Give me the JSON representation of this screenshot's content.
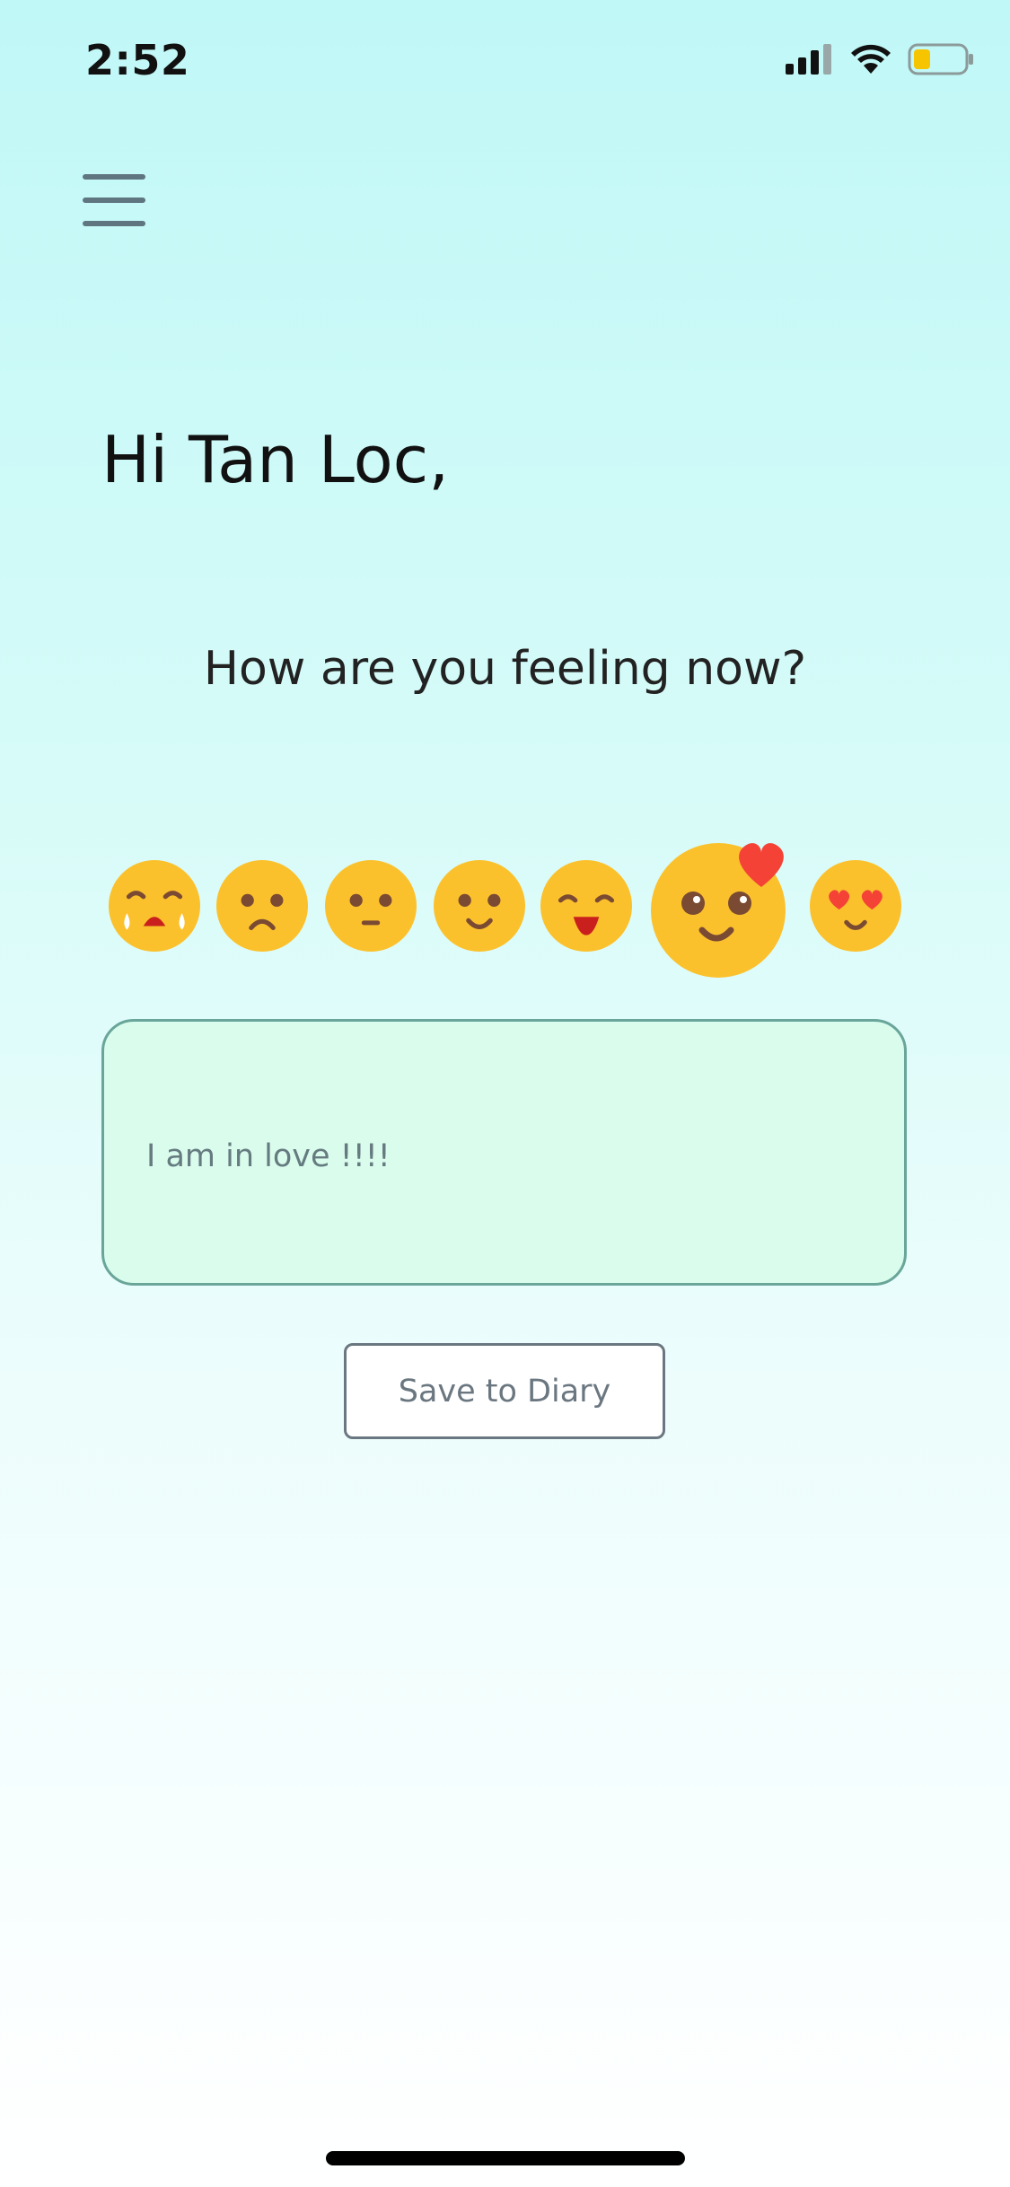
{
  "status_bar": {
    "time": "2:52",
    "icons": [
      "signal-icon",
      "wifi-icon",
      "battery-icon"
    ]
  },
  "header": {
    "menu_icon": "hamburger-menu-icon"
  },
  "greeting": "Hi Tan Loc,",
  "prompt": "How are you feeling now?",
  "moods": {
    "options": [
      "crying-face-icon",
      "sad-face-icon",
      "neutral-face-icon",
      "slight-smile-face-icon",
      "happy-face-icon",
      "in-love-heart-face-icon",
      "heart-eyes-face-icon"
    ],
    "selected": "in-love-heart-face-icon"
  },
  "note": {
    "value": "I am in love !!!!"
  },
  "actions": {
    "save_label": "Save to Diary"
  },
  "colors": {
    "background_top": "#c0f8f7",
    "background_bottom": "#ffffff",
    "emoji_yellow": "#fbc12d",
    "emoji_features": "#7a4a32",
    "heart_red": "#f44336",
    "note_fill": "#d9fcec",
    "note_border": "#6aa59a",
    "button_border": "#6b7780"
  }
}
